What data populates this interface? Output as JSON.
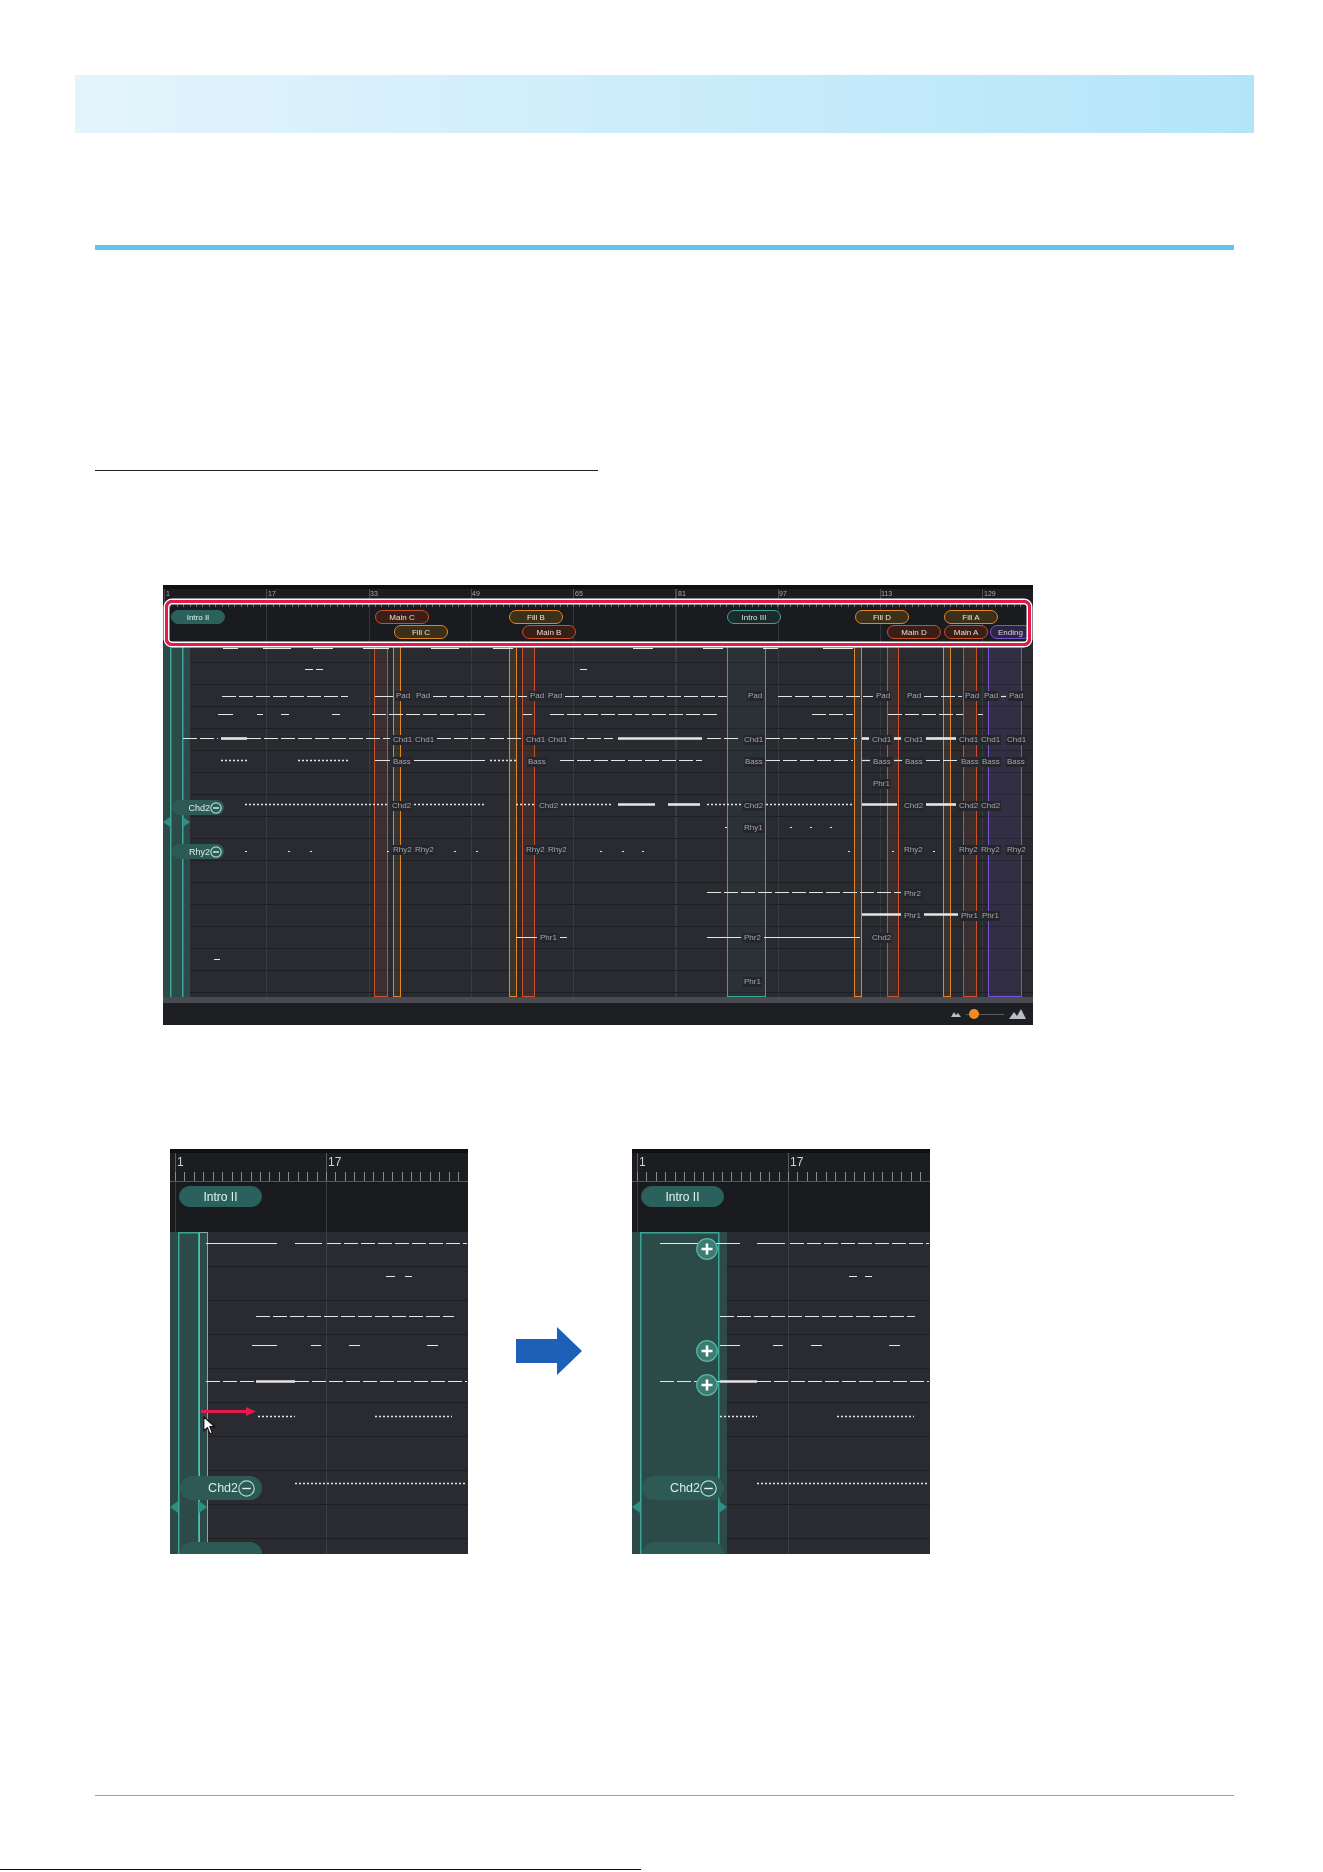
{
  "arrangement_view": {
    "ruler": {
      "bar_numbers": [
        "1",
        "17",
        "33",
        "49",
        "65",
        "81",
        "97",
        "113",
        "129"
      ]
    },
    "sections": [
      {
        "label": "Intro II",
        "kind": "intro",
        "selected": true
      },
      {
        "label": "Main C",
        "kind": "main",
        "selected": false
      },
      {
        "label": "Fill C",
        "kind": "fill",
        "selected": false
      },
      {
        "label": "Fill B",
        "kind": "fill",
        "selected": false
      },
      {
        "label": "Main B",
        "kind": "main",
        "selected": false
      },
      {
        "label": "Intro III",
        "kind": "intro",
        "selected": false
      },
      {
        "label": "Fill D",
        "kind": "fill",
        "selected": false
      },
      {
        "label": "Main D",
        "kind": "main",
        "selected": false
      },
      {
        "label": "Fill A",
        "kind": "fill",
        "selected": false
      },
      {
        "label": "Main A",
        "kind": "main",
        "selected": false
      },
      {
        "label": "Ending",
        "kind": "ending",
        "selected": false
      }
    ],
    "track_tabs": [
      {
        "label": "Chd2"
      },
      {
        "label": "Rhy2"
      }
    ],
    "part_labels": [
      "Pad",
      "Pad",
      "Pad",
      "Pad",
      "Pad",
      "Pad",
      "Pad",
      "Pad",
      "Pad",
      "Pad",
      "Chd1",
      "Chd1",
      "Chd1",
      "Chd1",
      "Chd1",
      "Chd1",
      "Chd1",
      "Chd1",
      "Chd1",
      "Chd1",
      "Bass",
      "Bass",
      "Bass",
      "Bass",
      "Bass",
      "Bass",
      "Bass",
      "Bass",
      "Phr1",
      "Chd2",
      "Chd2",
      "Chd2",
      "Chd2",
      "Chd2",
      "Chd2",
      "Rhy1",
      "Rhy2",
      "Rhy2",
      "Rhy2",
      "Rhy2",
      "Rhy2",
      "Rhy2",
      "Rhy2",
      "Rhy2",
      "Phr2",
      "Phr1",
      "Phr1",
      "Phr1",
      "Phr1",
      "Phr2",
      "Chd2",
      "Phr1"
    ],
    "zoom_slider": {
      "level": 0.1
    }
  },
  "before_view": {
    "ruler": {
      "bar_numbers": [
        "1",
        "17"
      ]
    },
    "sections": [
      {
        "label": "Intro II",
        "kind": "intro",
        "selected": true
      }
    ],
    "track_tabs": [
      {
        "label": "Chd2"
      }
    ]
  },
  "after_view": {
    "ruler": {
      "bar_numbers": [
        "1",
        "17"
      ]
    },
    "sections": [
      {
        "label": "Intro II",
        "kind": "intro",
        "selected": true
      }
    ],
    "track_tabs": [
      {
        "label": "Chd2"
      }
    ]
  }
}
